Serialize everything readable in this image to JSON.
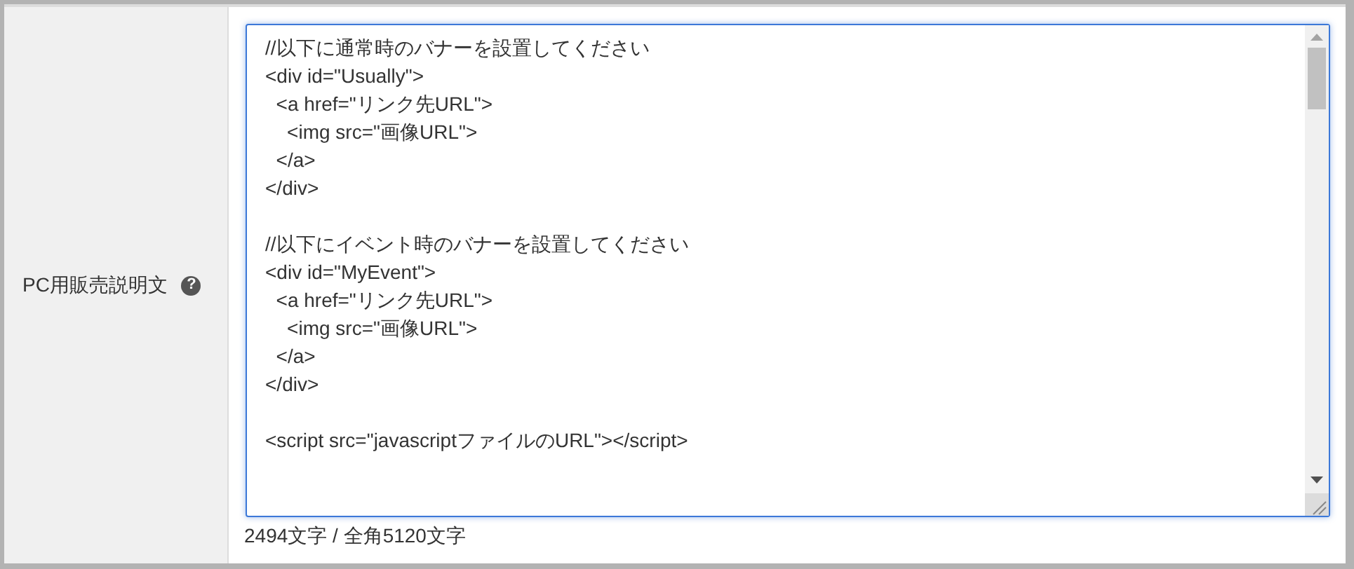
{
  "field": {
    "label": "PC用販売説明文",
    "help": "?"
  },
  "editor": {
    "blocks": [
      [
        "//以下に通常時のバナーを設置してください",
        "<div id=\"Usually\">",
        "  <a href=\"リンク先URL\">",
        "    <img src=\"画像URL\">",
        "  </a>",
        "</div>"
      ],
      [
        "//以下にイベント時のバナーを設置してください",
        "<div id=\"MyEvent\">",
        "  <a href=\"リンク先URL\">",
        "    <img src=\"画像URL\">",
        "  </a>",
        "</div>"
      ],
      [
        "<script src=\"javascriptファイルのURL\"></script>"
      ]
    ],
    "focused": true
  },
  "counter": "2494文字 / 全角5120文字"
}
